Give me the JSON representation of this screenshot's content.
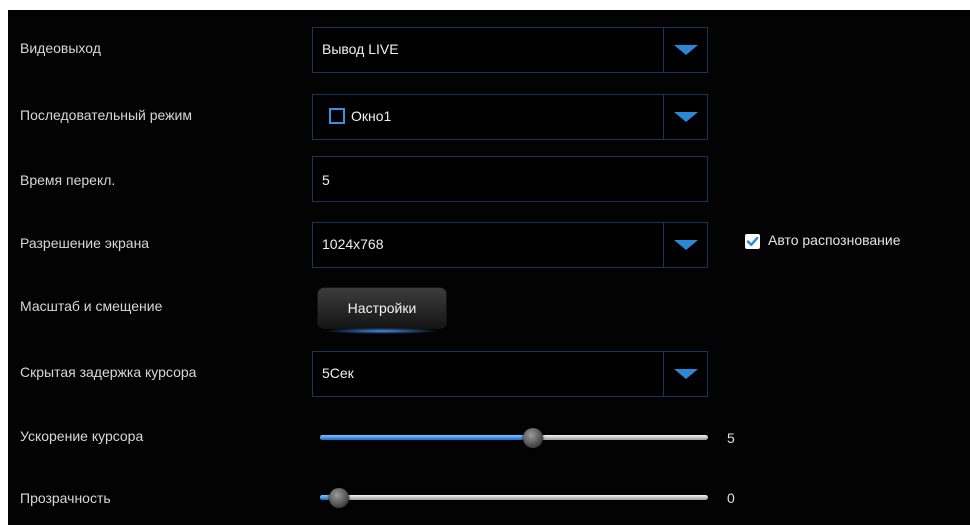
{
  "settings": {
    "video_output": {
      "label": "Видеовыход",
      "value": "Вывод LIVE"
    },
    "sequence_mode": {
      "label": "Последовательный режим",
      "value": "Окно1",
      "checked": false
    },
    "switch_time": {
      "label": "Время перекл.",
      "value": "5"
    },
    "resolution": {
      "label": "Разрешение экрана",
      "value": "1024x768",
      "auto_detect_label": "Авто распознование",
      "auto_detect_checked": true
    },
    "scale_offset": {
      "label": "Масштаб и смещение",
      "button_label": "Настройки"
    },
    "cursor_hide_delay": {
      "label": "Скрытая задержка курсора",
      "value": "5Сек"
    },
    "cursor_acceleration": {
      "label": "Ускорение курсора",
      "value": "5",
      "level_fraction": 0.55
    },
    "transparency": {
      "label": "Прозрачность",
      "value": "0",
      "level_fraction": 0.05
    }
  },
  "colors": {
    "background": "#030303",
    "accent": "#2d86d6",
    "border": "#17365e",
    "text": "#d8d8d8"
  },
  "icons": {
    "dropdown": "triangle-down-icon",
    "checkbox": "checkmark-icon"
  }
}
